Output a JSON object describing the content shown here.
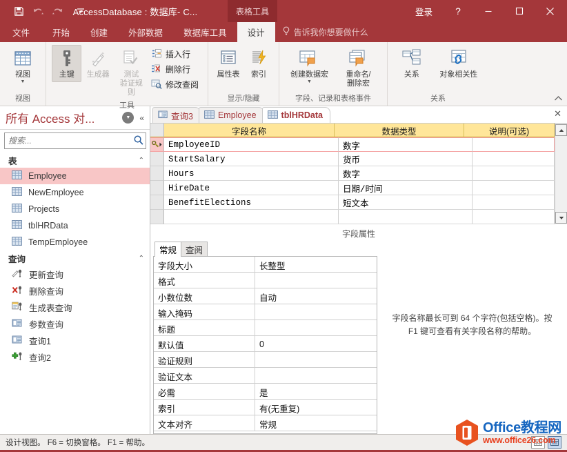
{
  "titlebar": {
    "title": "AccessDatabase : 数据库- C...",
    "contextual_tool": "表格工具",
    "signin": "登录",
    "help": "?",
    "quick_access": [
      {
        "name": "save-icon",
        "label": "保存"
      },
      {
        "name": "undo-icon",
        "label": "撤消"
      },
      {
        "name": "redo-icon",
        "label": "恢复"
      },
      {
        "name": "customize-qat-icon",
        "label": "自定义快速访问工具栏"
      }
    ],
    "window_buttons": {
      "minimize": "—",
      "maximize": "□",
      "close": "✕"
    }
  },
  "ribbon_tabs": {
    "items": [
      {
        "label": "文件",
        "active": false
      },
      {
        "label": "开始",
        "active": false
      },
      {
        "label": "创建",
        "active": false
      },
      {
        "label": "外部数据",
        "active": false
      },
      {
        "label": "数据库工具",
        "active": false
      },
      {
        "label": "设计",
        "active": true
      }
    ],
    "tell_me": "告诉我你想要做什么"
  },
  "ribbon": {
    "groups": [
      {
        "label": "视图",
        "buttons": [
          {
            "label": "视图",
            "icon": "table-view-icon",
            "dropdown": true,
            "state": "normal"
          }
        ]
      },
      {
        "label": "工具",
        "buttons": [
          {
            "label": "主键",
            "icon": "primary-key-icon",
            "state": "selected"
          },
          {
            "label": "生成器",
            "icon": "builder-wand-icon",
            "state": "disabled"
          },
          {
            "label": "测试\n验证规则",
            "icon": "test-validation-rules-icon",
            "state": "disabled"
          }
        ],
        "small_buttons": [
          {
            "label": "插入行",
            "icon": "insert-row-icon"
          },
          {
            "label": "删除行",
            "icon": "delete-row-icon"
          },
          {
            "label": "修改查阅",
            "icon": "modify-lookup-icon"
          }
        ]
      },
      {
        "label": "显示/隐藏",
        "buttons": [
          {
            "label": "属性表",
            "icon": "property-sheet-icon",
            "state": "normal"
          },
          {
            "label": "索引",
            "icon": "indexes-icon",
            "state": "normal"
          }
        ]
      },
      {
        "label": "字段、记录和表格事件",
        "buttons": [
          {
            "label": "创建数据宏",
            "icon": "create-data-macro-icon",
            "dropdown": true,
            "state": "normal"
          },
          {
            "label": "重命名/\n删除宏",
            "icon": "rename-delete-macro-icon",
            "state": "normal"
          }
        ]
      },
      {
        "label": "关系",
        "buttons": [
          {
            "label": "关系",
            "icon": "relationships-icon",
            "state": "normal"
          },
          {
            "label": "对象相关性",
            "icon": "object-dependencies-icon",
            "state": "normal"
          }
        ]
      }
    ],
    "collapse_label": "折叠功能区"
  },
  "navpane": {
    "title": "所有 Access 对...",
    "search_placeholder": "搜索...",
    "search_value": "",
    "groups": [
      {
        "label": "表",
        "items": [
          {
            "label": "Employee",
            "icon": "table-icon",
            "selected": true
          },
          {
            "label": "NewEmployee",
            "icon": "table-icon",
            "selected": false
          },
          {
            "label": "Projects",
            "icon": "table-icon",
            "selected": false
          },
          {
            "label": "tblHRData",
            "icon": "table-icon",
            "selected": false
          },
          {
            "label": "TempEmployee",
            "icon": "table-icon",
            "selected": false
          }
        ]
      },
      {
        "label": "查询",
        "items": [
          {
            "label": "更新查询",
            "icon": "update-query-icon",
            "selected": false
          },
          {
            "label": "删除查询",
            "icon": "delete-query-icon",
            "selected": false
          },
          {
            "label": "生成表查询",
            "icon": "make-table-query-icon",
            "selected": false
          },
          {
            "label": "参数查询",
            "icon": "parameter-query-icon",
            "selected": false
          },
          {
            "label": "查询1",
            "icon": "select-query-icon",
            "selected": false
          },
          {
            "label": "查询2",
            "icon": "append-query-icon",
            "selected": false
          }
        ]
      }
    ]
  },
  "document": {
    "tabs": [
      {
        "label": "查询3",
        "icon": "query-icon",
        "active": false
      },
      {
        "label": "Employee",
        "icon": "table-icon",
        "active": false
      },
      {
        "label": "tblHRData",
        "icon": "table-icon",
        "active": true
      }
    ],
    "close_label": "✕"
  },
  "design_grid": {
    "columns": [
      "字段名称",
      "数据类型",
      "说明(可选)"
    ],
    "rows": [
      {
        "field_name": "EmployeeID",
        "data_type": "数字",
        "description": "",
        "primary_key": true,
        "current": true
      },
      {
        "field_name": "StartSalary",
        "data_type": "货币",
        "description": "",
        "primary_key": false,
        "current": false
      },
      {
        "field_name": "Hours",
        "data_type": "数字",
        "description": "",
        "primary_key": false,
        "current": false
      },
      {
        "field_name": "HireDate",
        "data_type": "日期/时间",
        "description": "",
        "primary_key": false,
        "current": false
      },
      {
        "field_name": "BenefitElections",
        "data_type": "短文本",
        "description": "",
        "primary_key": false,
        "current": false
      }
    ]
  },
  "field_properties": {
    "title": "字段属性",
    "tabs": [
      {
        "label": "常规",
        "active": true
      },
      {
        "label": "查阅",
        "active": false
      }
    ],
    "rows": [
      {
        "name": "字段大小",
        "value": "长整型"
      },
      {
        "name": "格式",
        "value": ""
      },
      {
        "name": "小数位数",
        "value": "自动"
      },
      {
        "name": "输入掩码",
        "value": ""
      },
      {
        "name": "标题",
        "value": ""
      },
      {
        "name": "默认值",
        "value": "0"
      },
      {
        "name": "验证规则",
        "value": ""
      },
      {
        "name": "验证文本",
        "value": ""
      },
      {
        "name": "必需",
        "value": "是"
      },
      {
        "name": "索引",
        "value": "有(无重复)"
      },
      {
        "name": "文本对齐",
        "value": "常规"
      }
    ],
    "help_text": "字段名称最长可到 64 个字符(包括空格)。按 F1 键可查看有关字段名称的帮助。"
  },
  "statusbar": {
    "text": "设计视图。  F6 = 切换窗格。  F1 = 帮助。",
    "view_buttons": [
      {
        "name": "datasheet-view-icon",
        "active": false
      },
      {
        "name": "design-view-icon",
        "active": true
      }
    ]
  },
  "watermark": {
    "line1": "Office教程网",
    "line2": "www.office26.com"
  },
  "colors": {
    "accent": "#a4373a",
    "contextual_tool": "#8e2b2e",
    "ribbon_bg": "#f5f3f2",
    "grid_header": "#ffe699",
    "selection": "#f8c6c6",
    "current_row_border": "#f5a3a3"
  }
}
